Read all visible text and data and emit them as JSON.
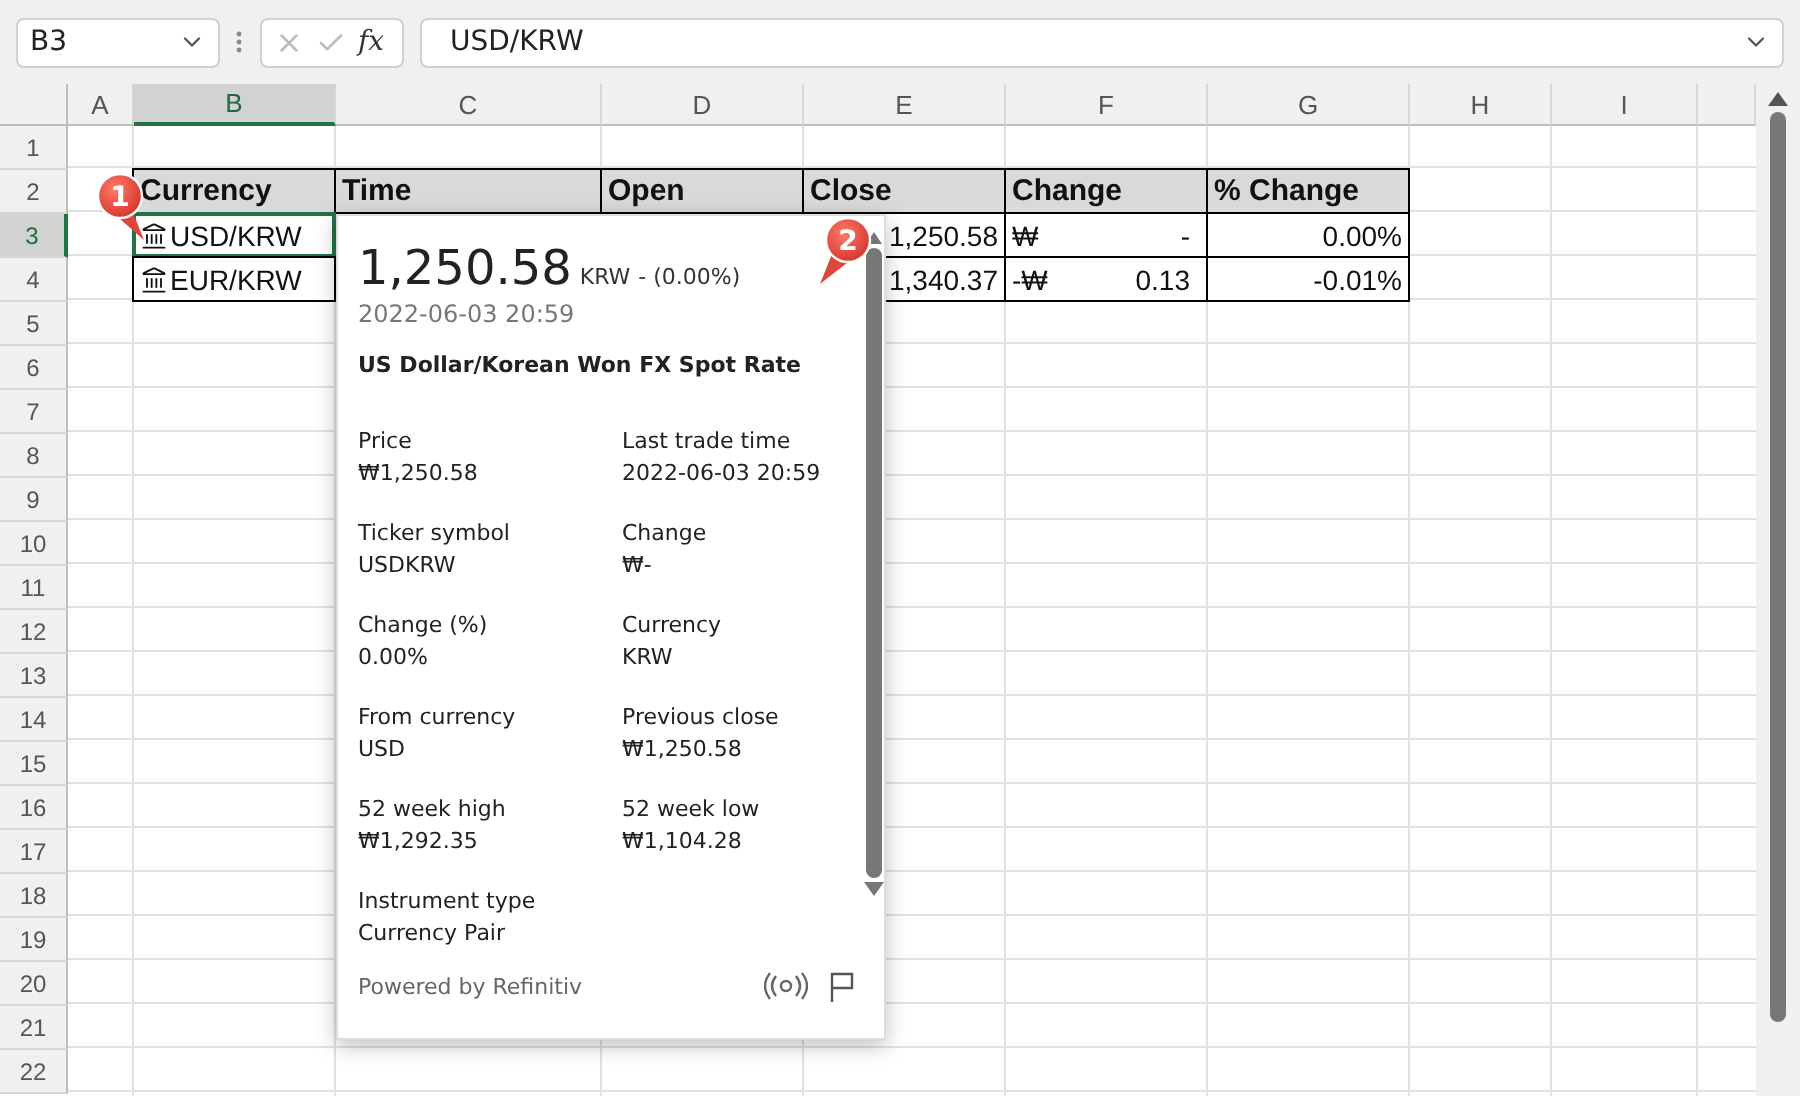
{
  "name_box": {
    "value": "B3"
  },
  "formula_bar": {
    "function_label": "fx",
    "value": "USD/KRW"
  },
  "columns": [
    {
      "label": "A",
      "selected": false
    },
    {
      "label": "B",
      "selected": true
    },
    {
      "label": "C",
      "selected": false
    },
    {
      "label": "D",
      "selected": false
    },
    {
      "label": "E",
      "selected": false
    },
    {
      "label": "F",
      "selected": false
    },
    {
      "label": "G",
      "selected": false
    },
    {
      "label": "H",
      "selected": false
    },
    {
      "label": "I",
      "selected": false
    }
  ],
  "rows": [
    {
      "label": "1",
      "selected": false
    },
    {
      "label": "2",
      "selected": false
    },
    {
      "label": "3",
      "selected": true
    },
    {
      "label": "4",
      "selected": false
    },
    {
      "label": "5",
      "selected": false
    },
    {
      "label": "6",
      "selected": false
    },
    {
      "label": "7",
      "selected": false
    },
    {
      "label": "8",
      "selected": false
    },
    {
      "label": "9",
      "selected": false
    },
    {
      "label": "10",
      "selected": false
    },
    {
      "label": "11",
      "selected": false
    },
    {
      "label": "12",
      "selected": false
    },
    {
      "label": "13",
      "selected": false
    },
    {
      "label": "14",
      "selected": false
    },
    {
      "label": "15",
      "selected": false
    },
    {
      "label": "16",
      "selected": false
    },
    {
      "label": "17",
      "selected": false
    },
    {
      "label": "18",
      "selected": false
    },
    {
      "label": "19",
      "selected": false
    },
    {
      "label": "20",
      "selected": false
    },
    {
      "label": "21",
      "selected": false
    },
    {
      "label": "22",
      "selected": false
    }
  ],
  "table": {
    "headers": [
      "Currency",
      "Time",
      "Open",
      "Close",
      "Change",
      "% Change"
    ],
    "rows": [
      {
        "currency": "USD/KRW",
        "selected": true,
        "close": "1,250.58",
        "change_symbol": "₩",
        "change": "-",
        "percent_change": "0.00%"
      },
      {
        "currency": "EUR/KRW",
        "selected": false,
        "close": "1,340.37",
        "change_symbol": "-₩",
        "change": "0.13",
        "percent_change": "-0.01%"
      }
    ]
  },
  "card": {
    "price": "1,250.58",
    "unit": "KRW",
    "delta": "- (0.00%)",
    "time": "2022-06-03 20:59",
    "title": "US Dollar/Korean Won FX Spot Rate",
    "fields": [
      {
        "label": "Price",
        "value": "₩1,250.58"
      },
      {
        "label": "Last trade time",
        "value": "2022-06-03 20:59"
      },
      {
        "label": "Ticker symbol",
        "value": "USDKRW"
      },
      {
        "label": "Change",
        "value": "₩-"
      },
      {
        "label": "Change (%)",
        "value": "0.00%"
      },
      {
        "label": "Currency",
        "value": "KRW"
      },
      {
        "label": "From currency",
        "value": "USD"
      },
      {
        "label": "Previous close",
        "value": "₩1,250.58"
      },
      {
        "label": "52 week high",
        "value": "₩1,292.35"
      },
      {
        "label": "52 week low",
        "value": "₩1,104.28"
      },
      {
        "label": "Instrument type",
        "value": "Currency Pair"
      }
    ],
    "footer": "Powered by Refinitiv"
  },
  "callouts": [
    {
      "label": "1"
    },
    {
      "label": "2"
    }
  ]
}
